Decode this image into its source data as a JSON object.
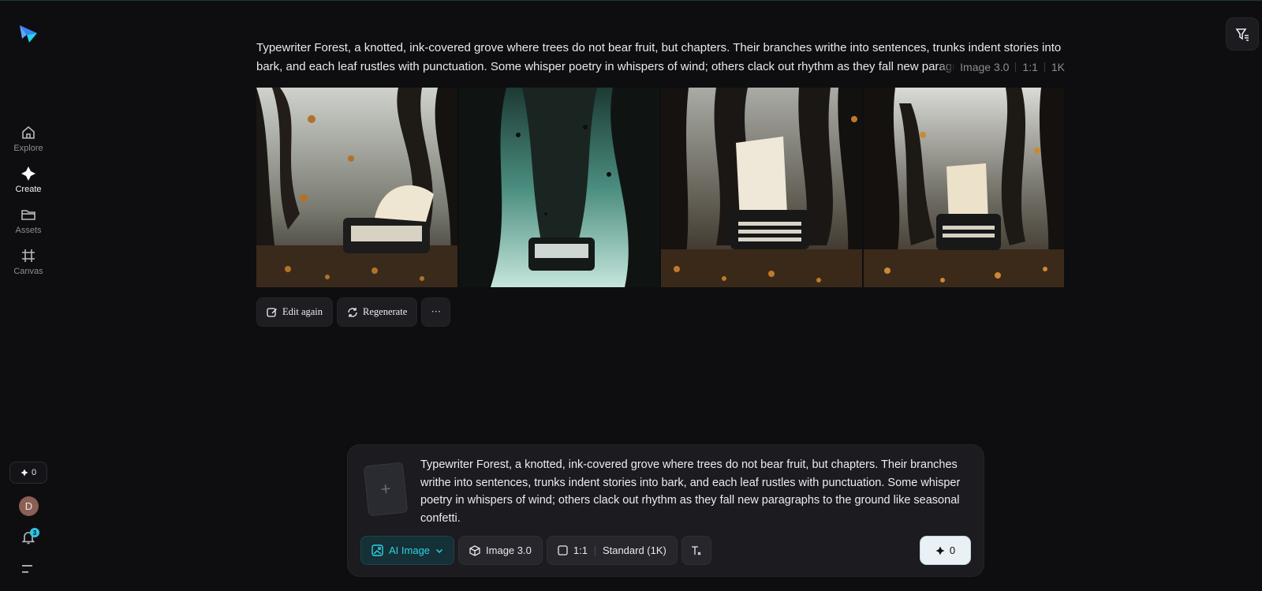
{
  "sidebar": {
    "items": [
      {
        "label": "Explore",
        "icon": "home-icon"
      },
      {
        "label": "Create",
        "icon": "sparkle-icon"
      },
      {
        "label": "Assets",
        "icon": "folder-icon"
      },
      {
        "label": "Canvas",
        "icon": "grid-hash-icon"
      }
    ],
    "credits": "0",
    "avatar_initial": "D",
    "notification_count": "3"
  },
  "result": {
    "prompt": "Typewriter Forest, a knotted, ink-covered grove where trees do not bear fruit, but chapters. Their branches writhe into sentences, trunks indent stories into bark, and each leaf rustles with punctuation. Some whisper poetry in whispers of wind; others clack out rhythm as they fall new paragraphs to the ground like seasonal confetti.",
    "model": "Image 3.0",
    "ratio": "1:1",
    "resolution": "1K",
    "actions": {
      "edit_again": "Edit again",
      "regenerate": "Regenerate",
      "more": "···"
    }
  },
  "composer": {
    "add_reference": "+",
    "prompt": "Typewriter Forest, a knotted, ink-covered grove where trees do not bear fruit, but chapters. Their branches writhe into sentences, trunks indent stories into bark, and each leaf rustles with punctuation. Some whisper poetry in whispers of wind; others clack out rhythm as they fall new paragraphs to the ground like seasonal confetti.",
    "mode": "AI Image",
    "model": "Image 3.0",
    "ratio": "1:1",
    "quality": "Standard (1K)",
    "send_credits": "0"
  },
  "colors": {
    "background": "#0e0e11",
    "accent": "#2dd2e6",
    "panel": "#1b1b20"
  }
}
